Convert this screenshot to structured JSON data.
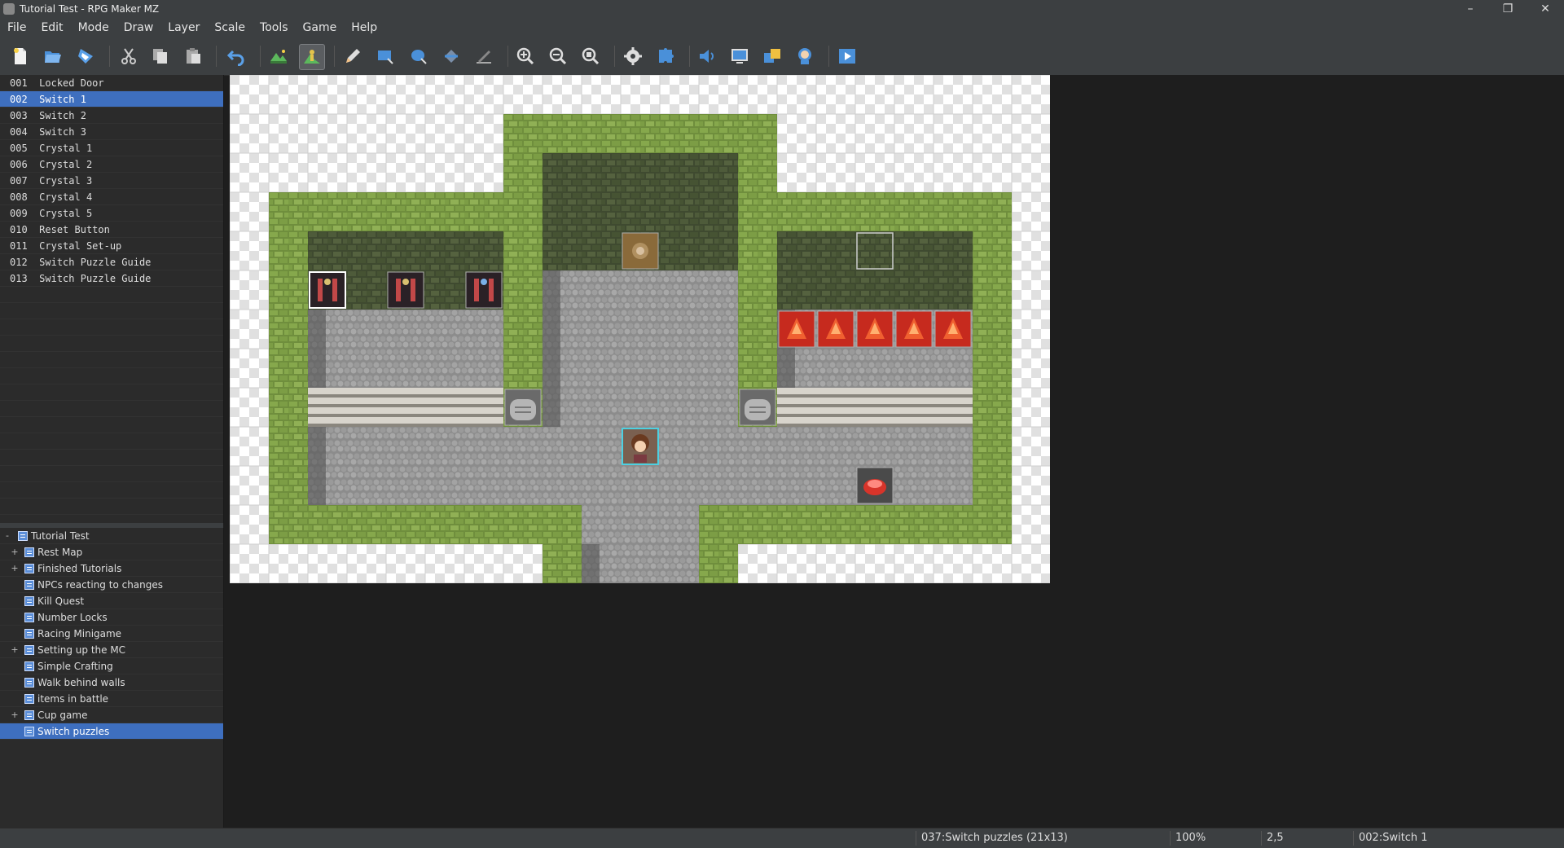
{
  "window": {
    "title": "Tutorial Test - RPG Maker MZ",
    "controls": [
      "–",
      "❐",
      "✕"
    ]
  },
  "menu": [
    "File",
    "Edit",
    "Mode",
    "Draw",
    "Layer",
    "Scale",
    "Tools",
    "Game",
    "Help"
  ],
  "toolbar": {
    "tools": [
      {
        "name": "new-project",
        "icon": "new-file-icon"
      },
      {
        "name": "open-project",
        "icon": "folder-open-icon"
      },
      {
        "name": "save-project",
        "icon": "save-icon"
      },
      {
        "name": "cut",
        "icon": "scissors-icon"
      },
      {
        "name": "copy",
        "icon": "copy-icon"
      },
      {
        "name": "paste",
        "icon": "paste-icon"
      },
      {
        "name": "undo",
        "icon": "undo-icon"
      },
      {
        "name": "map-mode",
        "icon": "map-mode-icon"
      },
      {
        "name": "event-mode",
        "icon": "event-mode-icon",
        "active": true
      },
      {
        "name": "pencil",
        "icon": "pencil-icon"
      },
      {
        "name": "rectangle",
        "icon": "rectangle-icon"
      },
      {
        "name": "ellipse",
        "icon": "ellipse-icon"
      },
      {
        "name": "flood-fill",
        "icon": "fill-icon"
      },
      {
        "name": "shadow-pen",
        "icon": "shadow-pen-icon"
      },
      {
        "name": "zoom-in",
        "icon": "zoom-in-icon"
      },
      {
        "name": "zoom-out",
        "icon": "zoom-out-icon"
      },
      {
        "name": "actual-size",
        "icon": "zoom-actual-icon"
      },
      {
        "name": "database",
        "icon": "gear-icon"
      },
      {
        "name": "plugin-manager",
        "icon": "puzzle-icon"
      },
      {
        "name": "sound-test",
        "icon": "speaker-icon"
      },
      {
        "name": "event-searcher",
        "icon": "search-screen-icon"
      },
      {
        "name": "resource-manager",
        "icon": "resource-icon"
      },
      {
        "name": "character-generator",
        "icon": "character-icon"
      },
      {
        "name": "playtest",
        "icon": "play-icon"
      }
    ]
  },
  "events": [
    {
      "id": "001",
      "name": "Locked Door"
    },
    {
      "id": "002",
      "name": "Switch 1",
      "selected": true
    },
    {
      "id": "003",
      "name": "Switch 2"
    },
    {
      "id": "004",
      "name": "Switch 3"
    },
    {
      "id": "005",
      "name": "Crystal 1"
    },
    {
      "id": "006",
      "name": "Crystal 2"
    },
    {
      "id": "007",
      "name": "Crystal 3"
    },
    {
      "id": "008",
      "name": "Crystal 4"
    },
    {
      "id": "009",
      "name": "Crystal 5"
    },
    {
      "id": "010",
      "name": "Reset Button"
    },
    {
      "id": "011",
      "name": "Crystal Set-up"
    },
    {
      "id": "012",
      "name": "Switch Puzzle Guide"
    },
    {
      "id": "013",
      "name": "Switch Puzzle Guide"
    }
  ],
  "map_tree": [
    {
      "label": "Tutorial Test",
      "depth": 0,
      "expander": "-",
      "root": true
    },
    {
      "label": "Rest Map",
      "depth": 1,
      "expander": "+"
    },
    {
      "label": "Finished Tutorials",
      "depth": 1,
      "expander": "+"
    },
    {
      "label": "NPCs reacting to changes",
      "depth": 1,
      "expander": ""
    },
    {
      "label": "Kill Quest",
      "depth": 1,
      "expander": ""
    },
    {
      "label": "Number Locks",
      "depth": 1,
      "expander": ""
    },
    {
      "label": "Racing Minigame",
      "depth": 1,
      "expander": ""
    },
    {
      "label": "Setting up the MC",
      "depth": 1,
      "expander": "+"
    },
    {
      "label": "Simple Crafting",
      "depth": 1,
      "expander": ""
    },
    {
      "label": "Walk behind walls",
      "depth": 1,
      "expander": ""
    },
    {
      "label": "items in battle",
      "depth": 1,
      "expander": ""
    },
    {
      "label": "Cup game",
      "depth": 1,
      "expander": "+"
    },
    {
      "label": "Switch puzzles",
      "depth": 1,
      "expander": "",
      "selected": true
    }
  ],
  "map": {
    "name": "Switch puzzles",
    "size": "21x13",
    "objects": [
      {
        "type": "lever-switch",
        "label": "Switch 1"
      },
      {
        "type": "lever-switch",
        "label": "Switch 2"
      },
      {
        "type": "lever-switch",
        "label": "Switch 3"
      },
      {
        "type": "locked-door",
        "label": "Locked Door"
      },
      {
        "type": "crystal",
        "label": "Crystal 1"
      },
      {
        "type": "crystal",
        "label": "Crystal 2"
      },
      {
        "type": "crystal",
        "label": "Crystal 3"
      },
      {
        "type": "crystal",
        "label": "Crystal 4"
      },
      {
        "type": "crystal",
        "label": "Crystal 5"
      },
      {
        "type": "sign",
        "label": "Switch Puzzle Guide"
      },
      {
        "type": "sign",
        "label": "Switch Puzzle Guide"
      },
      {
        "type": "reset-button",
        "label": "Reset Button"
      },
      {
        "type": "empty-event",
        "label": "Crystal Set-up"
      },
      {
        "type": "player-start",
        "label": "Player start"
      }
    ]
  },
  "status": {
    "map": "037:Switch puzzles (21x13)",
    "zoom": "100%",
    "coords": "2,5",
    "event": "002:Switch 1"
  }
}
